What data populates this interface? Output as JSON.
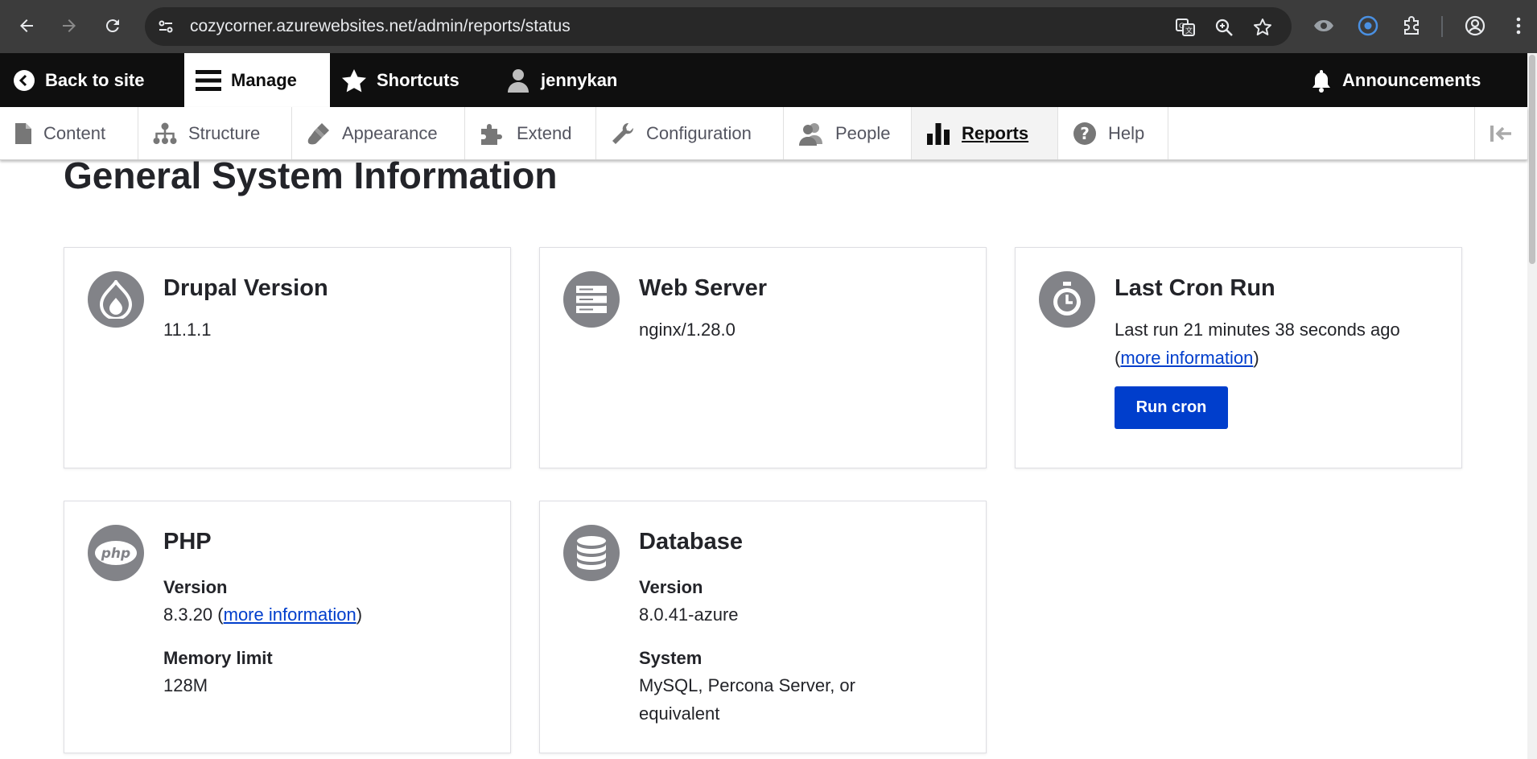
{
  "browser": {
    "url": "cozycorner.azurewebsites.net/admin/reports/status"
  },
  "toolbar": {
    "back_to_site": "Back to site",
    "manage": "Manage",
    "shortcuts": "Shortcuts",
    "user": "jennykan",
    "announcements": "Announcements"
  },
  "tray": {
    "items": [
      "Content",
      "Structure",
      "Appearance",
      "Extend",
      "Configuration",
      "People",
      "Reports",
      "Help"
    ],
    "active": "Reports"
  },
  "page": {
    "title": "General System Information"
  },
  "cards": {
    "drupal": {
      "title": "Drupal Version",
      "value": "11.1.1"
    },
    "webserver": {
      "title": "Web Server",
      "value": "nginx/1.28.0"
    },
    "cron": {
      "title": "Last Cron Run",
      "text": "Last run 21 minutes 38 seconds ago",
      "open_paren": "(",
      "link": "more information",
      "close_paren": ")",
      "button": "Run cron"
    },
    "php": {
      "title": "PHP",
      "version_label": "Version",
      "version": "8.3.20",
      "open_paren": " (",
      "link": "more information",
      "close_paren": ")",
      "memory_label": "Memory limit",
      "memory": "128M",
      "icon_text": "php"
    },
    "database": {
      "title": "Database",
      "version_label": "Version",
      "version": "8.0.41-azure",
      "system_label": "System",
      "system_line1": "MySQL, Percona Server, or",
      "system_line2": "equivalent"
    }
  }
}
